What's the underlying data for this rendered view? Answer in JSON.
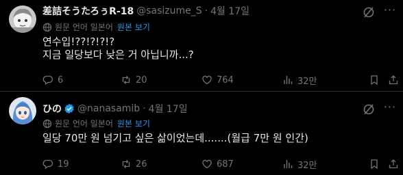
{
  "posts": [
    {
      "author_name": "差詰そうたろぅR-18",
      "handle": "@sasizume_S",
      "separator": "·",
      "time": "4월 17일",
      "verified": false,
      "translate_source": "원문 언어 일본어",
      "translate_action": "원본 보기",
      "text": "연수입!??!?!?!?\n지금 일당보다 낮은 거 아닙니까...?",
      "replies": "6",
      "reposts": "20",
      "likes": "764",
      "views": "32만"
    },
    {
      "author_name": "ひの",
      "handle": "@nanasamib",
      "separator": "·",
      "time": "4월 17일",
      "verified": true,
      "translate_source": "원문 언어 일본어",
      "translate_action": "원본 보기",
      "text": "일당 70만 원 넘기고 싶은 삶이었는데.......(월급 7만 원 인간)",
      "replies": "19",
      "reposts": "26",
      "likes": "687",
      "views": "32만"
    }
  ],
  "colors": {
    "background": "#000000",
    "text": "#e7e9ea",
    "muted": "#71767b",
    "accent": "#1d9bf0",
    "divider": "#2f3336"
  },
  "icons": [
    "grok-icon",
    "more-icon",
    "globe-icon",
    "reply-icon",
    "repost-icon",
    "like-icon",
    "views-icon",
    "bookmark-icon",
    "share-icon",
    "verified-badge-icon"
  ]
}
